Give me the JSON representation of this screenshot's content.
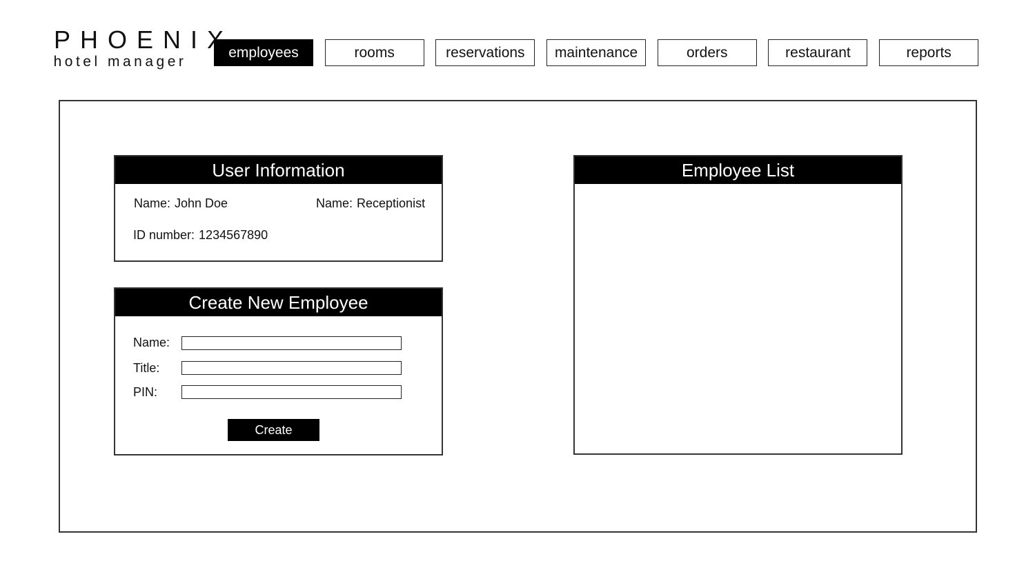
{
  "brand": {
    "title": "PHOENIX",
    "subtitle": "hotel manager"
  },
  "nav": {
    "active": "employees",
    "tabs": [
      {
        "label": "employees"
      },
      {
        "label": "rooms"
      },
      {
        "label": "reservations"
      },
      {
        "label": "maintenance"
      },
      {
        "label": "orders"
      },
      {
        "label": "restaurant"
      },
      {
        "label": "reports"
      }
    ]
  },
  "user_info": {
    "header": "User Information",
    "name_label": "Name:",
    "name_value": "John Doe",
    "title_label": "Name:",
    "title_value": "Receptionist",
    "id_label": "ID number:",
    "id_value": "1234567890"
  },
  "create_employee": {
    "header": "Create New Employee",
    "name_label": "Name:",
    "name_value": "",
    "title_label": "Title:",
    "title_value": "",
    "pin_label": "PIN:",
    "pin_value": "",
    "button_label": "Create"
  },
  "employee_list": {
    "header": "Employee List",
    "items": []
  },
  "colors": {
    "active_tab_bg": "#000000",
    "header_bg": "#000000",
    "border": "#333333",
    "background": "#ffffff"
  }
}
